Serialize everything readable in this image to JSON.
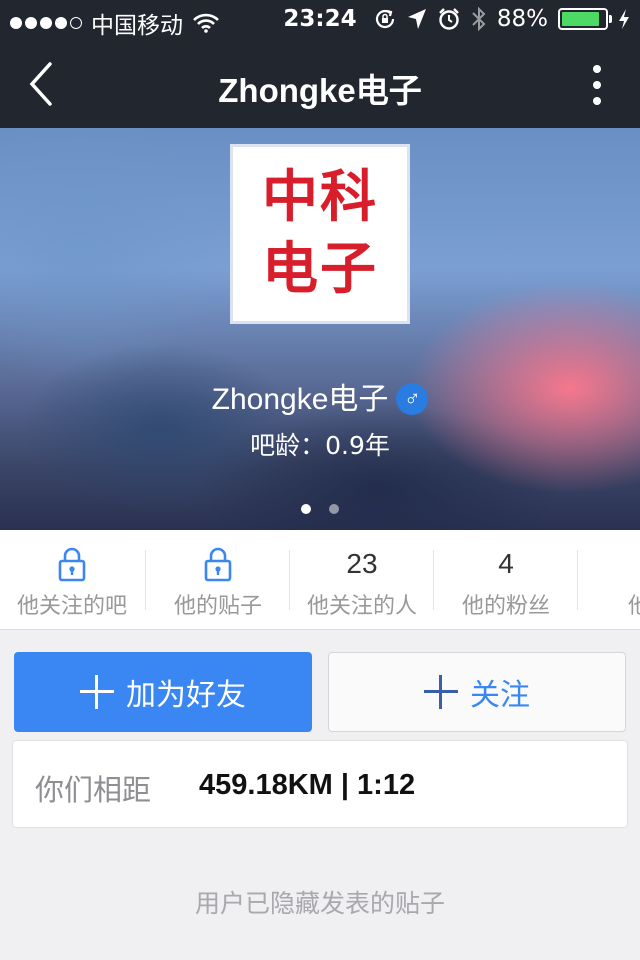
{
  "status_bar": {
    "carrier": "中国移动",
    "time": "23:24",
    "battery_percent": "88%",
    "battery_level": 0.88,
    "battery_color": "#4cd964"
  },
  "nav": {
    "title": "Zhongke电子",
    "back_icon": "chevron-left-icon",
    "more_icon": "more-vertical-icon"
  },
  "profile": {
    "avatar_logo_line1": "中科",
    "avatar_logo_line2": "电子",
    "name": "Zhongke电子",
    "gender_icon": "♂",
    "age": "吧龄：0.9年",
    "page_count": 2,
    "active_page": 1
  },
  "stats": [
    {
      "value": "",
      "locked": true,
      "label": "他关注的吧"
    },
    {
      "value": "",
      "locked": true,
      "label": "他的贴子"
    },
    {
      "value": "23",
      "locked": false,
      "label": "他关注的人"
    },
    {
      "value": "4",
      "locked": false,
      "label": "他的粉丝"
    },
    {
      "value": "",
      "locked": false,
      "label": "他的"
    }
  ],
  "actions": {
    "add_friend_label": "加为好友",
    "follow_label": "关注",
    "accent_color": "#3a86f2"
  },
  "distance": {
    "label": "你们相距",
    "value": "459.18KM | 1:12"
  },
  "posts_hidden_text": "用户已隐藏发表的贴子"
}
